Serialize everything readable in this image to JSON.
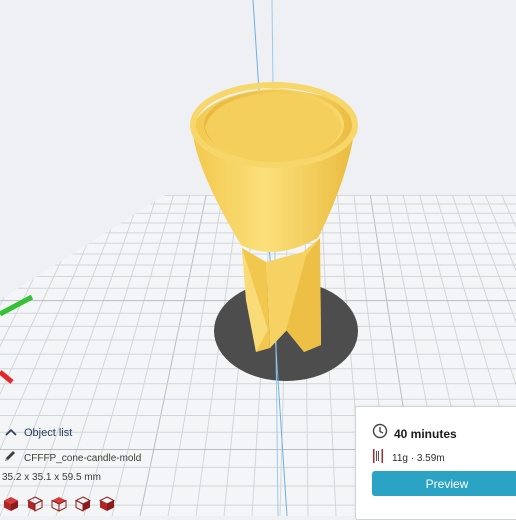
{
  "object_list": {
    "toggle_label": "Object list",
    "toggle_icon": "chevron-up-icon",
    "object_icon": "pencil-icon",
    "object_name": "CFFFP_cone-candle-mold",
    "dimensions": "35.2 x 35.1 x 59.5 mm",
    "view_buttons": [
      "3d-view-icon",
      "front-view-icon",
      "top-view-icon",
      "left-view-icon",
      "right-view-icon"
    ]
  },
  "print_info": {
    "time_icon": "clock-icon",
    "print_time": "40 minutes",
    "material_icon": "spool-icon",
    "material": "11g · 3.59m",
    "preview_label": "Preview"
  },
  "colors": {
    "accent": "#2ba3c4",
    "model": "#f7d25e",
    "build_plate": "#f4f5f6",
    "shadow": "#4d4d4d",
    "axis_x": "#e0282a",
    "axis_y": "#34c234",
    "axis_z": "#4b8fd6"
  }
}
